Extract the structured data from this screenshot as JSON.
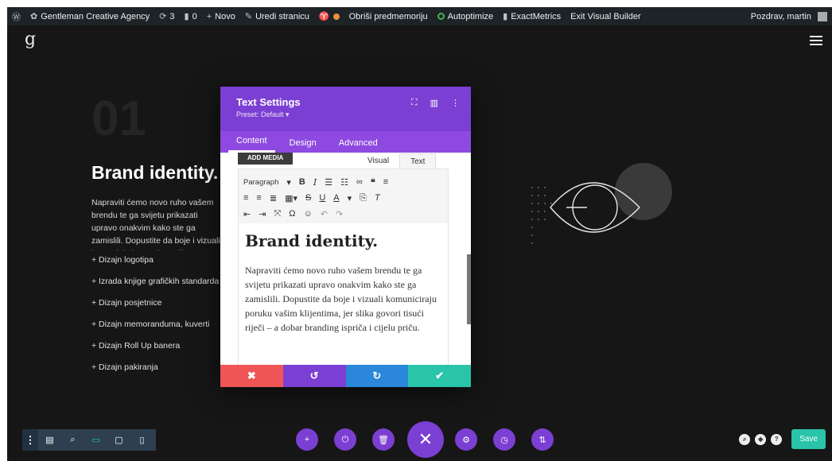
{
  "adminbar": {
    "site_name": "Gentleman Creative Agency",
    "updates_count": "3",
    "comments_count": "0",
    "new_label": "Novo",
    "edit_label": "Uredi stranicu",
    "clear_cache_label": "Obriši predmemoriju",
    "autoptimize_label": "Autoptimize",
    "exactmetrics_label": "ExactMetrics",
    "exit_label": "Exit Visual Builder",
    "greeting": "Pozdrav, martin"
  },
  "page": {
    "number": "01",
    "heading": "Brand identity.",
    "paragraph": "Napraviti ćemo novo ruho vašem brendu te ga svijetu prikazati upravo onakvim kako ste ga zamislili. Dopustite da boje i vizuali komuniciraju poruku vašim klijentima, jer slika govori tisući riječi – a dobar branding ispriča i cijelu priču.",
    "services": [
      "+ Dizajn logotipa",
      "+ Izrada knjige grafičkih standarda",
      "+ Dizajn posjetnice",
      "+ Dizajn memoranduma, kuverti",
      "+ Dizajn Roll Up banera",
      "+ Dizajn pakiranja"
    ]
  },
  "modal": {
    "title": "Text Settings",
    "preset": "Preset: Default ▾",
    "tabs": [
      "Content",
      "Design",
      "Advanced"
    ],
    "add_media": "ADD MEDIA",
    "editor_tabs": [
      "Visual",
      "Text"
    ],
    "format_select": "Paragraph",
    "content_heading": "Brand identity.",
    "content_paragraph": "Napraviti ćemo novo ruho vašem brendu te ga svijetu prikazati upravo onakvim kako ste ga zamislili. Dopustite da boje i vizuali komuniciraju poruku vašim klijentima, jer slika govori tisući riječi – a dobar branding ispriča i cijelu priču."
  },
  "footer": {
    "save_label": "Save"
  },
  "colors": {
    "accent": "#7c3fd3",
    "cancel": "#ef5555",
    "redo": "#2b87da",
    "confirm": "#29c4a9"
  }
}
